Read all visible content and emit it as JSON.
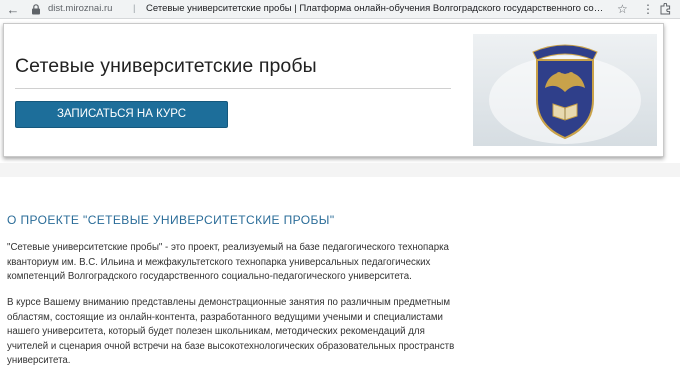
{
  "browser": {
    "domain": "dist.miroznai.ru",
    "separator": "|",
    "page_title": "Сетевые университетские пробы | Платформа онлайн-обучения Волгоградского государственного социа..."
  },
  "course": {
    "title": "Сетевые университетские пробы",
    "enroll_label": "ЗАПИСАТЬСЯ НА КУРС"
  },
  "about": {
    "heading": "О ПРОЕКТЕ \"СЕТЕВЫЕ УНИВЕРСИТЕТСКИЕ ПРОБЫ\"",
    "paragraph1": "\"Сетевые университетские пробы\" - это проект, реализуемый на базе педагогического технопарка кванториум им. В.С. Ильина и межфакультетского технопарка универсальных педагогических компетенций Волгоградского государственного социально-педагогического университета.",
    "paragraph2": "В курсе Вашему вниманию представлены демонстрационные занятия по различным предметным областям, состоящие из онлайн-контента, разработанного ведущими учеными и специалистами нашего университета, который будет полезен школьникам, методических рекомендаций для учителей и сценария очной встречи на базе высокотехнологических образовательных пространств университета."
  },
  "colors": {
    "accent": "#1d6e9a",
    "heading": "#2a6c98",
    "emblem_shield": "#2f3f8a",
    "emblem_gold": "#c9a24a"
  },
  "icons": [
    "back-arrow-icon",
    "lock-icon",
    "star-icon",
    "menu-dots-icon",
    "extension-icon"
  ]
}
